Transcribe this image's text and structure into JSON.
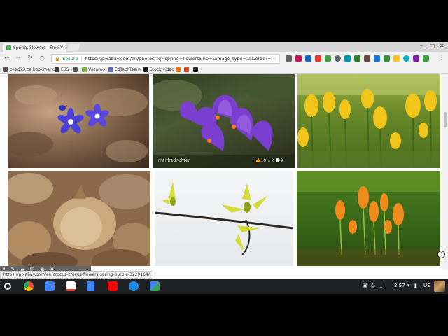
{
  "browser": {
    "tab_title": "Spring, Flowers - Free p",
    "secure_label": "Secure",
    "url": "https://pixabay.com/en/photos/?q=spring+flowers&hp=&image_type=all&order=&cat=&mi...",
    "status_url": "https://pixabay.com/en/crocus-crocus-flowers-spring-purple-3229164/"
  },
  "bookmarks": [
    {
      "label": "ceed73.ca bookmarks",
      "icon": "folder-icon",
      "color": "#555555"
    },
    {
      "label": "ESS",
      "icon": "globe-icon",
      "color": "#333333"
    },
    {
      "label": "Vocaroo",
      "icon": "vocaroo-icon",
      "color": "#7cb342"
    },
    {
      "label": "EdTechTeam",
      "icon": "edtechteam-icon",
      "color": "#5c6bc0"
    },
    {
      "label": "Stock video",
      "icon": "stock-video-icon",
      "color": "#222222"
    }
  ],
  "photos": [
    {
      "subject": "blue hepatica flowers",
      "credit": ""
    },
    {
      "subject": "purple crocus flowers",
      "credit": "manfredrichter",
      "likes": "10",
      "favorites": "2",
      "comments": "9"
    },
    {
      "subject": "yellow crocus field",
      "credit": ""
    },
    {
      "subject": "flower bulbs",
      "credit": ""
    },
    {
      "subject": "budding branch",
      "credit": ""
    },
    {
      "subject": "orange crocus in grass",
      "credit": ""
    }
  ],
  "shelf": {
    "time": "2:57",
    "locale": "US"
  }
}
